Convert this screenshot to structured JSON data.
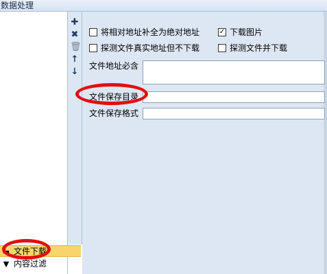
{
  "window": {
    "title": "数据处理"
  },
  "toolbar": {
    "add_icon": "plus-icon",
    "delete_icon": "close-icon",
    "trash_icon": "trash-icon",
    "up_icon": "arrow-up-icon",
    "down_icon": "arrow-down-icon"
  },
  "list": {
    "items": [
      {
        "label": "文件下载",
        "icon": "download-icon",
        "selected": true
      },
      {
        "label": "内容过滤",
        "icon": "filter-icon",
        "selected": false
      }
    ]
  },
  "options": {
    "to_absolute": {
      "label": "将相对地址补全为绝对地址",
      "checked": false
    },
    "download_images": {
      "label": "下载图片",
      "checked": true
    },
    "probe_no_download": {
      "label": "探测文件真实地址但不下载",
      "checked": false
    },
    "probe_and_download": {
      "label": "探测文件并下载",
      "checked": false
    }
  },
  "fields": {
    "required_url_label": "文件地址必含",
    "required_url_value": "",
    "save_dir_label": "文件保存目录",
    "save_dir_value": "",
    "save_format_label": "文件保存格式",
    "save_format_value": ""
  },
  "colors": {
    "highlight_ellipse": "#e01010",
    "selected_item": "#f6d56b",
    "panel_bg": "#dde7f3"
  }
}
